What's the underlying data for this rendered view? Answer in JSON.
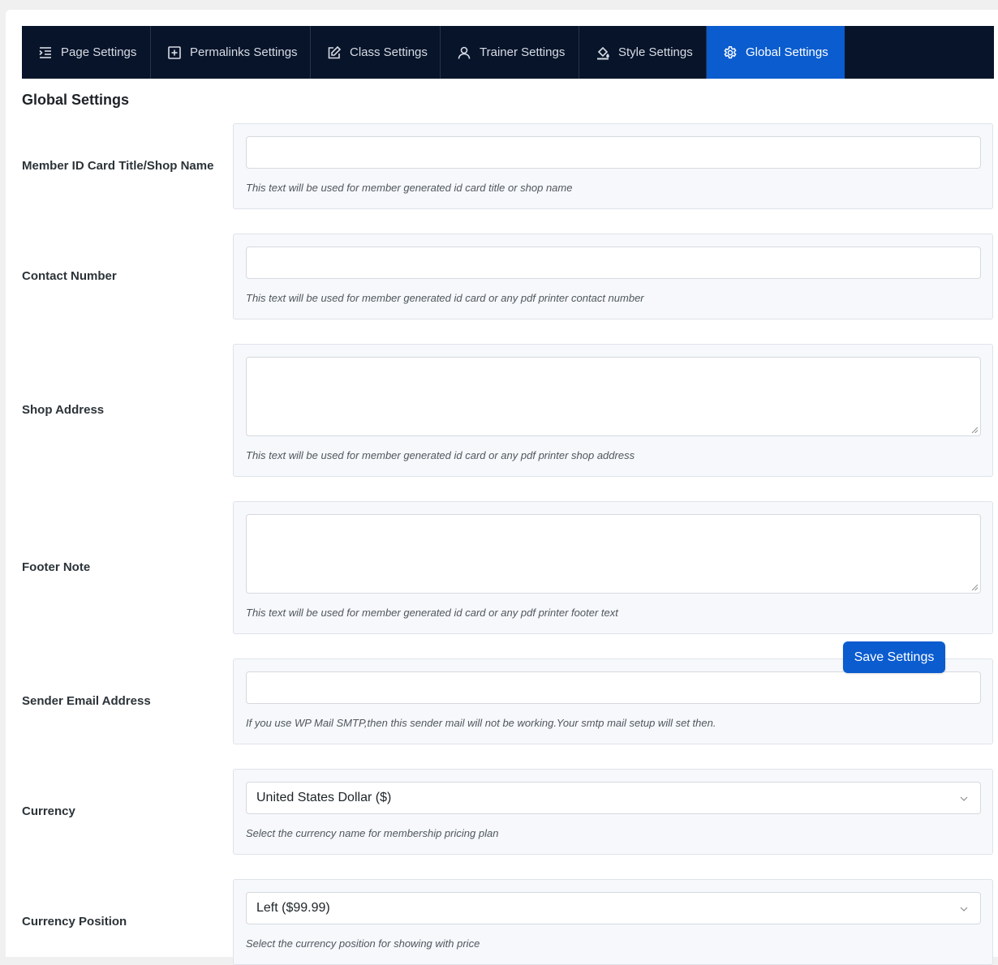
{
  "tabs": [
    {
      "label": "Page Settings",
      "icon": "list-indent-icon"
    },
    {
      "label": "Permalinks Settings",
      "icon": "plus-square-icon"
    },
    {
      "label": "Class Settings",
      "icon": "edit-icon"
    },
    {
      "label": "Trainer Settings",
      "icon": "user-icon"
    },
    {
      "label": "Style Settings",
      "icon": "paint-bucket-icon"
    },
    {
      "label": "Global Settings",
      "icon": "gear-icon",
      "active": true
    }
  ],
  "page_title": "Global Settings",
  "fields": {
    "shop_name": {
      "label": "Member ID Card Title/Shop Name",
      "value": "",
      "help": "This text will be used for member generated id card title or shop name"
    },
    "contact_number": {
      "label": "Contact Number",
      "value": "",
      "help": "This text will be used for member generated id card or any pdf printer contact number"
    },
    "shop_address": {
      "label": "Shop Address",
      "value": "",
      "help": "This text will be used for member generated id card or any pdf printer shop address"
    },
    "footer_note": {
      "label": "Footer Note",
      "value": "",
      "help": "This text will be used for member generated id card or any pdf printer footer text"
    },
    "sender_email": {
      "label": "Sender Email Address",
      "value": "",
      "help": "If you use WP Mail SMTP,then this sender mail will not be working.Your smtp mail setup will set then."
    },
    "currency": {
      "label": "Currency",
      "selected": "United States Dollar ($)",
      "help": "Select the currency name for membership pricing plan"
    },
    "currency_position": {
      "label": "Currency Position",
      "selected": "Left ($99.99)",
      "help": "Select the currency position for showing with price"
    }
  },
  "save_button": "Save Settings",
  "colors": {
    "nav_bg": "#07142a",
    "accent": "#0a5ccf"
  }
}
